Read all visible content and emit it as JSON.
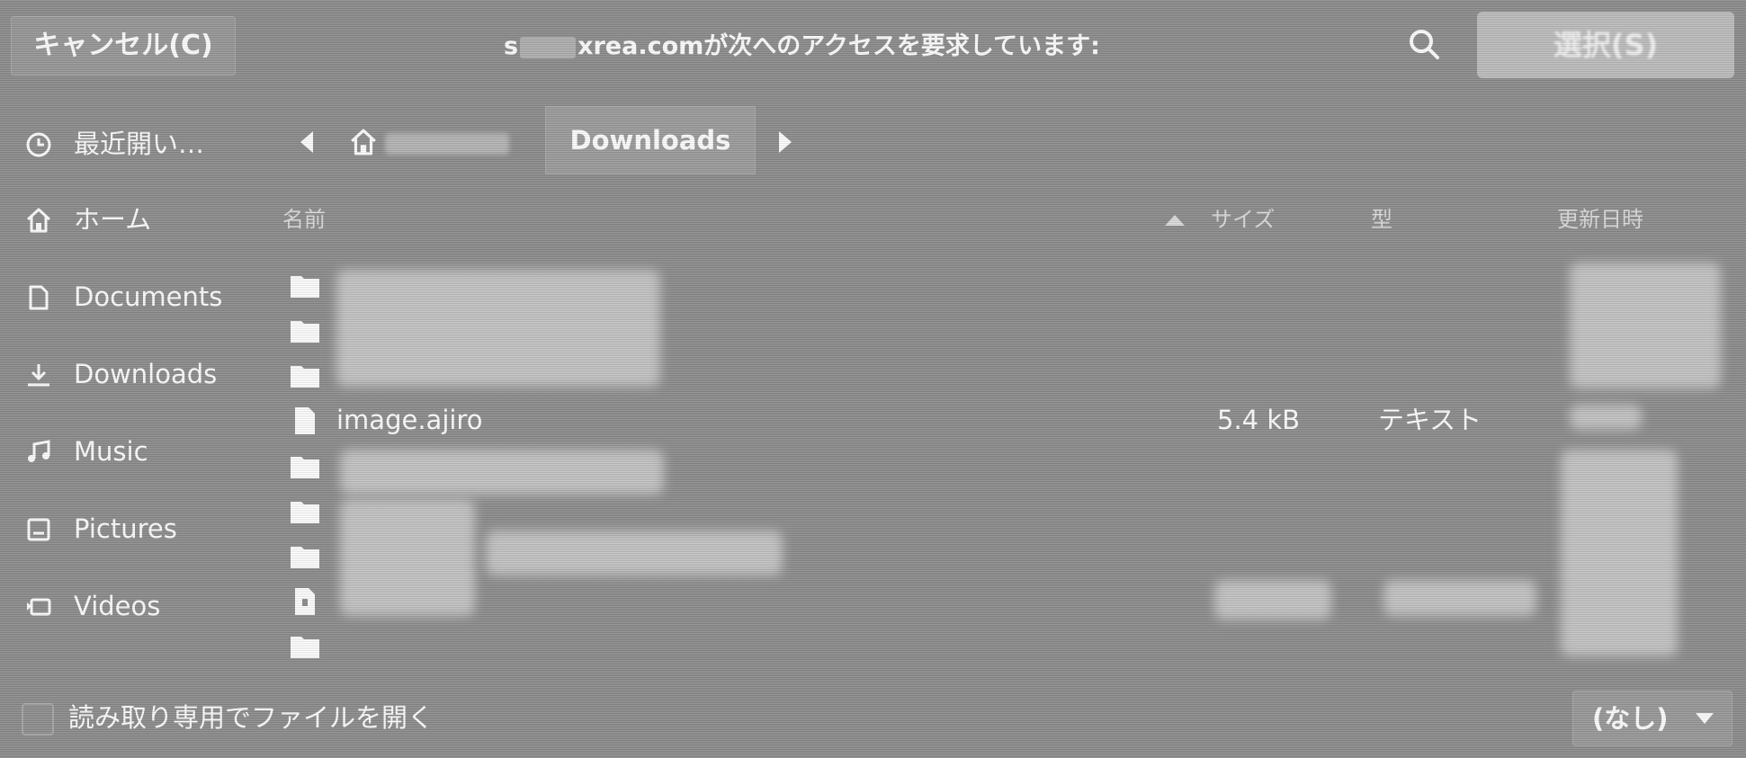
{
  "header": {
    "cancel_label": "キャンセル(C)",
    "title_prefix": "s",
    "title_rest": "xrea.comが次へのアクセスを要求しています:",
    "select_label": "選択(S)"
  },
  "sidebar": {
    "items": [
      {
        "label": "最近開い…",
        "icon": "clock-icon"
      },
      {
        "label": "ホーム",
        "icon": "home-icon"
      },
      {
        "label": "Documents",
        "icon": "document-icon"
      },
      {
        "label": "Downloads",
        "icon": "download-icon"
      },
      {
        "label": "Music",
        "icon": "music-icon"
      },
      {
        "label": "Pictures",
        "icon": "picture-icon"
      },
      {
        "label": "Videos",
        "icon": "video-icon"
      }
    ]
  },
  "pathbar": {
    "current": "Downloads"
  },
  "columns": {
    "name": "名前",
    "size": "サイズ",
    "type": "型",
    "modified": "更新日時"
  },
  "files": [
    {
      "kind": "folder",
      "name": "",
      "size": "",
      "type": ""
    },
    {
      "kind": "folder",
      "name": "",
      "size": "",
      "type": ""
    },
    {
      "kind": "folder",
      "name": "",
      "size": "",
      "type": ""
    },
    {
      "kind": "file",
      "name": "image.ajiro",
      "size": "5.4 kB",
      "type": "テキスト"
    },
    {
      "kind": "folder",
      "name": "",
      "size": "",
      "type": ""
    },
    {
      "kind": "folder",
      "name": "",
      "size": "",
      "type": ""
    },
    {
      "kind": "folder",
      "name": "",
      "size": "",
      "type": ""
    },
    {
      "kind": "archive",
      "name": "",
      "size": "",
      "type": ""
    },
    {
      "kind": "folder",
      "name": "",
      "size": "",
      "type": ""
    }
  ],
  "footer": {
    "readonly_label": "読み取り専用でファイルを開く",
    "filter_value": "(なし)"
  }
}
